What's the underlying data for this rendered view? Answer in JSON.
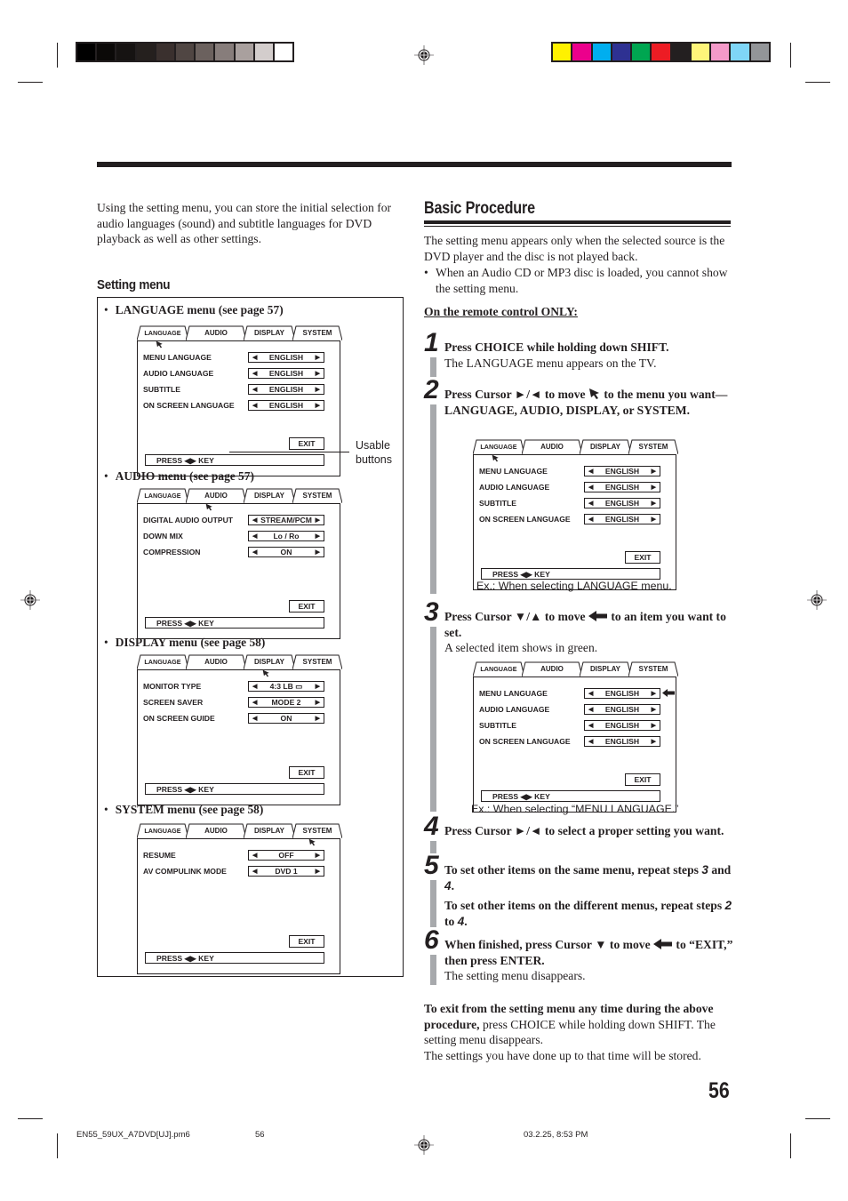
{
  "printer_marks": {
    "grayscale_bar": [
      "#000000",
      "#0b0908",
      "#161312",
      "#25201e",
      "#3a302e",
      "#504643",
      "#6b615e",
      "#877d7b",
      "#a9a09e",
      "#d3cdcc",
      "#ffffff"
    ],
    "color_bar": [
      "#fff100",
      "#ec008c",
      "#00aeef",
      "#2e3192",
      "#00a651",
      "#ed1c24",
      "#231f20",
      "#fff57a",
      "#f49ac9",
      "#7fd6f7",
      "#939598"
    ]
  },
  "intro": "Using the setting menu, you can store the initial selection for audio languages (sound) and subtitle languages for DVD playback as well as other settings.",
  "setting_menu": {
    "heading": "Setting menu",
    "annotation": "Usable buttons",
    "menus": [
      {
        "bullet": "LANGUAGE menu (see page 57)",
        "active_tab": 0,
        "tabs": [
          "LANGUAGE",
          "AUDIO",
          "DISPLAY",
          "SYSTEM"
        ],
        "items": [
          {
            "label": "MENU LANGUAGE",
            "value": "ENGLISH"
          },
          {
            "label": "AUDIO LANGUAGE",
            "value": "ENGLISH"
          },
          {
            "label": "SUBTITLE",
            "value": "ENGLISH"
          },
          {
            "label": "ON SCREEN LANGUAGE",
            "value": "ENGLISH"
          }
        ],
        "exit": "EXIT",
        "press": "PRESS ◀▶ KEY"
      },
      {
        "bullet": "AUDIO menu (see page 57)",
        "active_tab": 1,
        "tabs": [
          "LANGUAGE",
          "AUDIO",
          "DISPLAY",
          "SYSTEM"
        ],
        "items": [
          {
            "label": "DIGITAL AUDIO OUTPUT",
            "value": "STREAM/PCM"
          },
          {
            "label": "DOWN MIX",
            "value": "Lo / Ro"
          },
          {
            "label": "COMPRESSION",
            "value": "ON"
          }
        ],
        "exit": "EXIT",
        "press": "PRESS ◀▶ KEY"
      },
      {
        "bullet": "DISPLAY menu (see page 58)",
        "active_tab": 2,
        "tabs": [
          "LANGUAGE",
          "AUDIO",
          "DISPLAY",
          "SYSTEM"
        ],
        "items": [
          {
            "label": "MONITOR TYPE",
            "value": "4:3 LB ▭"
          },
          {
            "label": "SCREEN SAVER",
            "value": "MODE 2"
          },
          {
            "label": "ON SCREEN GUIDE",
            "value": "ON"
          }
        ],
        "exit": "EXIT",
        "press": "PRESS ◀▶ KEY"
      },
      {
        "bullet": "SYSTEM menu (see page 58)",
        "active_tab": 3,
        "tabs": [
          "LANGUAGE",
          "AUDIO",
          "DISPLAY",
          "SYSTEM"
        ],
        "items": [
          {
            "label": "RESUME",
            "value": "OFF"
          },
          {
            "label": "AV COMPULINK MODE",
            "value": "DVD 1"
          }
        ],
        "exit": "EXIT",
        "press": "PRESS ◀▶ KEY"
      }
    ]
  },
  "basic_procedure": {
    "heading": "Basic Procedure",
    "p1": "The setting menu appears only when the selected source is the DVD player and the disc is not played back.",
    "note": "When an Audio CD or MP3 disc is loaded, you cannot show the setting menu.",
    "remote_only": "On the remote control ONLY:",
    "steps": [
      {
        "num": "1",
        "bold": "Press CHOICE while holding down SHIFT.",
        "normal": "The LANGUAGE menu appears on the TV."
      },
      {
        "num": "2",
        "bold_a": "Press Cursor ►/◄ to move",
        "bold_b": "to the menu you want—LANGUAGE, AUDIO, DISPLAY, or SYSTEM."
      },
      {
        "num": "3",
        "bold_a": "Press Cursor ▼/▲ to move",
        "bold_b": "to an item you want to set.",
        "normal": "A selected item shows in green."
      },
      {
        "num": "4",
        "bold": "Press Cursor ►/◄ to select a proper setting you want."
      },
      {
        "num": "5",
        "bold_a": "To set other items on the same menu, repeat steps",
        "ref_a": "3",
        "bold_and": "and",
        "ref_b": "4",
        "bold2_a": "To set other items on the different menus, repeat steps",
        "ref_c": "2",
        "bold2_to": "to",
        "ref_d": "4"
      },
      {
        "num": "6",
        "bold_a": "When finished, press Cursor ▼ to move",
        "bold_b": "to “EXIT,” then press ENTER.",
        "normal": "The setting menu disappears."
      }
    ],
    "example1": {
      "caption": "Ex.: When selecting LANGUAGE menu.",
      "tabs": [
        "LANGUAGE",
        "AUDIO",
        "DISPLAY",
        "SYSTEM"
      ],
      "items": [
        {
          "label": "MENU LANGUAGE",
          "value": "ENGLISH"
        },
        {
          "label": "AUDIO LANGUAGE",
          "value": "ENGLISH"
        },
        {
          "label": "SUBTITLE",
          "value": "ENGLISH"
        },
        {
          "label": "ON SCREEN LANGUAGE",
          "value": "ENGLISH"
        }
      ],
      "exit": "EXIT",
      "press": "PRESS ◀▶ KEY"
    },
    "example2": {
      "caption": "Ex.: When selecting “MENU LANGUAGE.”",
      "tabs": [
        "LANGUAGE",
        "AUDIO",
        "DISPLAY",
        "SYSTEM"
      ],
      "items": [
        {
          "label": "MENU LANGUAGE",
          "value": "ENGLISH"
        },
        {
          "label": "AUDIO LANGUAGE",
          "value": "ENGLISH"
        },
        {
          "label": "SUBTITLE",
          "value": "ENGLISH"
        },
        {
          "label": "ON SCREEN LANGUAGE",
          "value": "ENGLISH"
        }
      ],
      "exit": "EXIT",
      "press": "PRESS ◀▶ KEY"
    },
    "exit_note_bold": "To exit from the setting menu any time during the above procedure,",
    "exit_note_normal": " press CHOICE while holding down SHIFT. The setting menu disappears.",
    "stored_note": "The settings you have done up to that time will be stored."
  },
  "page_number": "56",
  "footer": {
    "file": "EN55_59UX_A7DVD[UJ].pm6",
    "page": "56",
    "datetime": "03.2.25, 8:53 PM"
  }
}
